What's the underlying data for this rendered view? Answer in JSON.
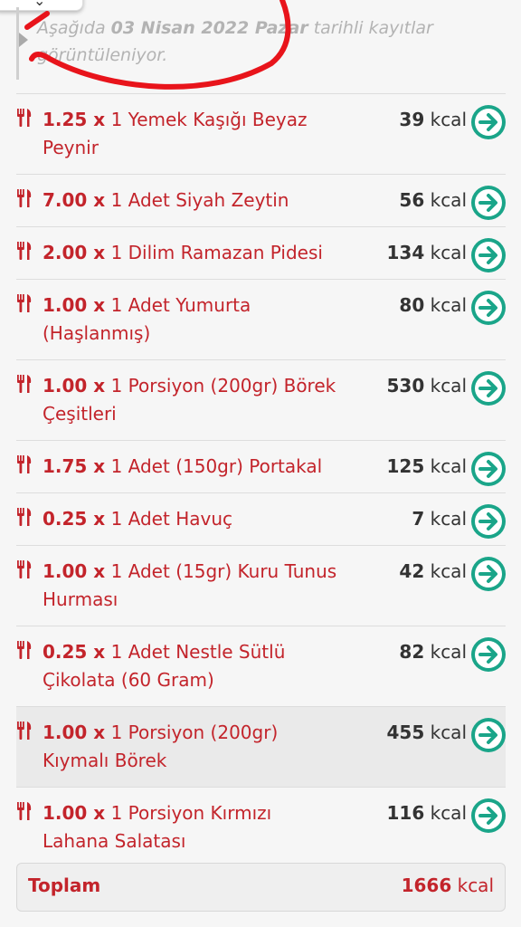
{
  "colors": {
    "accent_red": "#c3242b",
    "go_green": "#1aa589",
    "muted_text": "#b3b3b3",
    "scribble_red": "#e8141b"
  },
  "info": {
    "prefix": "Aşağıda ",
    "date": "03 Nisan 2022 Pazar",
    "suffix": " tarihli kayıtlar görüntüleniyor."
  },
  "items": [
    {
      "qty": "1.25 x",
      "desc": " 1 Yemek Kaşığı Beyaz Peynir",
      "kcal": "39",
      "unit": " kcal"
    },
    {
      "qty": "7.00 x",
      "desc": " 1 Adet Siyah Zeytin",
      "kcal": "56",
      "unit": " kcal"
    },
    {
      "qty": "2.00 x",
      "desc": " 1 Dilim Ramazan Pidesi",
      "kcal": "134",
      "unit": " kcal"
    },
    {
      "qty": "1.00 x",
      "desc": " 1 Adet Yumurta (Haşlanmış)",
      "kcal": "80",
      "unit": " kcal"
    },
    {
      "qty": "1.00 x",
      "desc": " 1 Porsiyon (200gr) Börek Çeşitleri",
      "kcal": "530",
      "unit": " kcal"
    },
    {
      "qty": "1.75 x",
      "desc": " 1 Adet (150gr) Portakal",
      "kcal": "125",
      "unit": " kcal"
    },
    {
      "qty": "0.25 x",
      "desc": " 1 Adet Havuç",
      "kcal": "7",
      "unit": " kcal"
    },
    {
      "qty": "1.00 x",
      "desc": " 1 Adet (15gr) Kuru Tunus Hurması",
      "kcal": "42",
      "unit": " kcal"
    },
    {
      "qty": "0.25 x",
      "desc": " 1 Adet Nestle Sütlü Çikolata (60 Gram)",
      "kcal": "82",
      "unit": " kcal"
    },
    {
      "qty": "1.00 x",
      "desc": " 1 Porsiyon (200gr) Kıymalı Börek",
      "kcal": "455",
      "unit": " kcal"
    },
    {
      "qty": "1.00 x",
      "desc": " 1 Porsiyon Kırmızı Lahana Salatası",
      "kcal": "116",
      "unit": " kcal"
    }
  ],
  "total": {
    "label": "Toplam",
    "value": "1666",
    "unit": " kcal"
  },
  "icons": {
    "item_icon": "fork-knife-icon",
    "go_icon": "arrow-right-circle-icon",
    "top_icon": "chevron-down-icon"
  }
}
